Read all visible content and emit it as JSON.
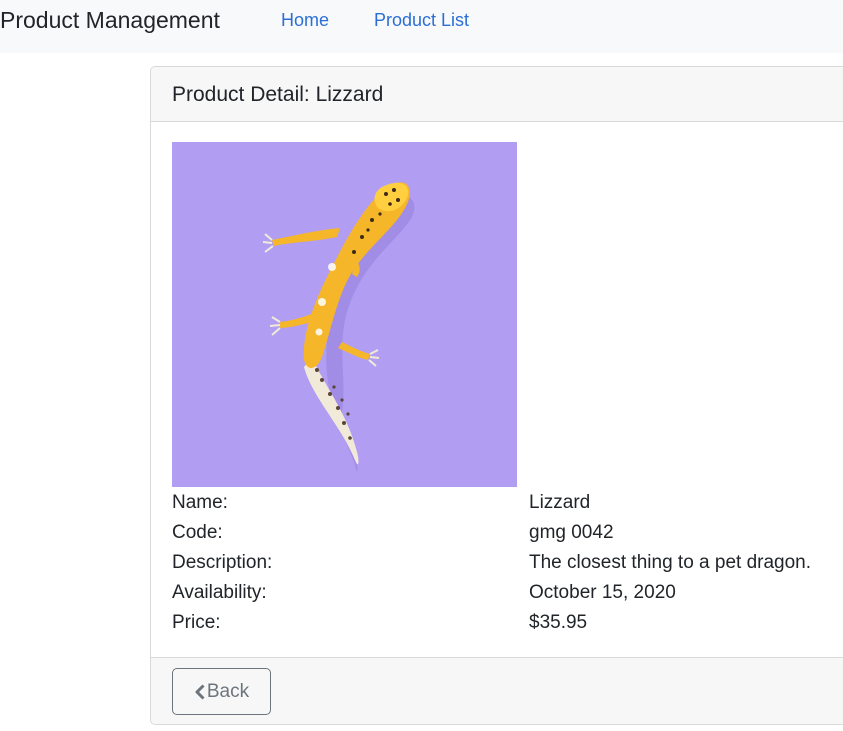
{
  "navbar": {
    "brand": "Product Management",
    "links": [
      {
        "label": "Home"
      },
      {
        "label": "Product List"
      }
    ]
  },
  "card": {
    "header_title": "Product Detail: Lizzard",
    "image": {
      "subject": "leopard gecko photo",
      "background_color": "#b19ef2"
    },
    "details": [
      {
        "label": "Name:",
        "value": "Lizzard"
      },
      {
        "label": "Code:",
        "value": "gmg 0042"
      },
      {
        "label": "Description:",
        "value": "The closest thing to a pet dragon."
      },
      {
        "label": "Availability:",
        "value": "October 15, 2020"
      },
      {
        "label": "Price:",
        "value": "$35.95"
      }
    ],
    "footer": {
      "back_label": "Back",
      "back_icon": "chevron-left-icon"
    }
  },
  "colors": {
    "link": "#2a6fd6",
    "navbar_bg": "#f8f9fa",
    "card_header_bg": "#f7f7f7",
    "button_outline": "#6c757d"
  }
}
